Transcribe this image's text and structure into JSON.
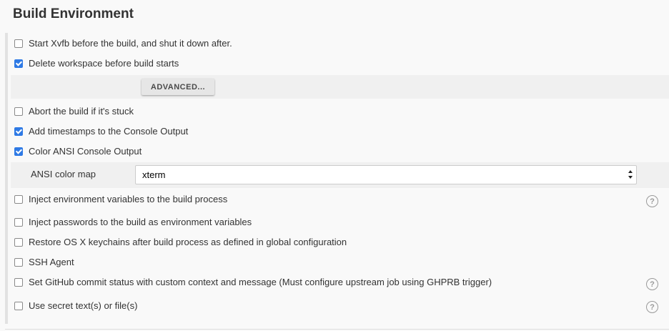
{
  "section": {
    "title": "Build Environment"
  },
  "options": [
    {
      "label": "Start Xvfb before the build, and shut it down after.",
      "checked": false
    },
    {
      "label": "Delete workspace before build starts",
      "checked": true
    },
    {
      "label": "Abort the build if it's stuck",
      "checked": false
    },
    {
      "label": "Add timestamps to the Console Output",
      "checked": true
    },
    {
      "label": "Color ANSI Console Output",
      "checked": true
    },
    {
      "label": "Inject environment variables to the build process",
      "checked": false
    },
    {
      "label": "Inject passwords to the build as environment variables",
      "checked": false
    },
    {
      "label": "Restore OS X keychains after build process as defined in global configuration",
      "checked": false
    },
    {
      "label": "SSH Agent",
      "checked": false
    },
    {
      "label": "Set GitHub commit status with custom context and message (Must configure upstream job using GHPRB trigger)",
      "checked": false
    },
    {
      "label": "Use secret text(s) or file(s)",
      "checked": false
    }
  ],
  "advanced": {
    "label": "ADVANCED..."
  },
  "ansi": {
    "label": "ANSI color map",
    "selected": "xterm"
  },
  "help": {
    "glyph": "?"
  },
  "colors": {
    "accent": "#2f7ae5",
    "background": "#f9f9f9",
    "band": "#f0f0f0"
  }
}
